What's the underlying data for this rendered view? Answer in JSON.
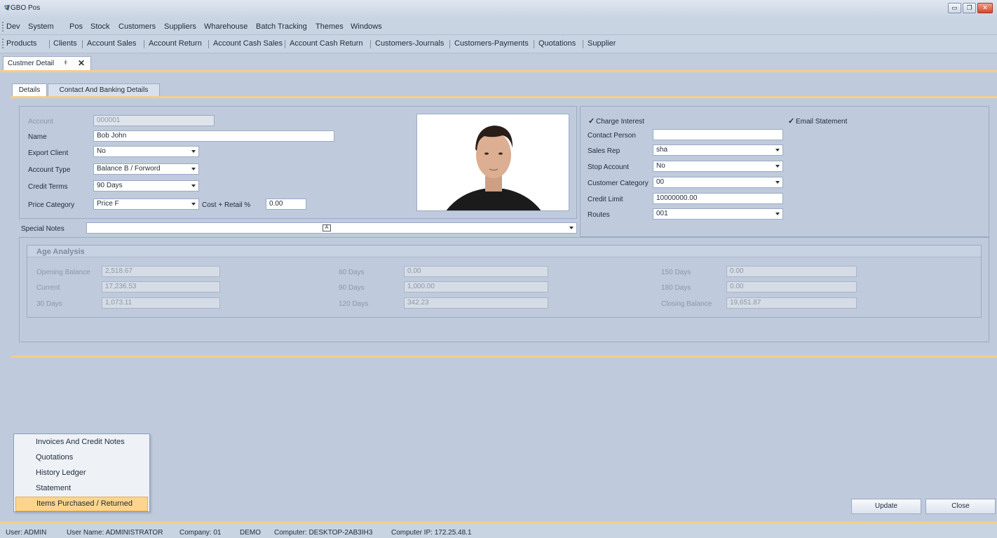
{
  "window": {
    "title": "GBO Pos"
  },
  "menu": [
    "Dev",
    "System",
    "Pos",
    "Stock",
    "Customers",
    "Suppliers",
    "Wharehouse",
    "Batch Tracking",
    "Themes",
    "Windows"
  ],
  "quick_links": [
    "Products",
    "Clients",
    "Account Sales",
    "Account Return",
    "Account Cash Sales",
    "Account Cash Return",
    "Customers-Journals",
    "Customers-Payments",
    "Quotations",
    "Supplier"
  ],
  "document_tab": {
    "label": "Custmer Detail",
    "pin": "ǂ",
    "close": "✕"
  },
  "tabs": {
    "details": "Details",
    "contact": "Contact And Banking Details"
  },
  "form": {
    "account_label": "Account",
    "account_value": "000001",
    "name_label": "Name",
    "name_value": "Bob John",
    "export_client_label": "Export Client",
    "export_client_value": "No",
    "account_type_label": "Account Type",
    "account_type_value": "Balance B / Forword",
    "credit_terms_label": "Credit Terms",
    "credit_terms_value": "90 Days",
    "price_category_label": "Price Category",
    "price_category_value": "Price F",
    "cost_retail_label": "Cost + Retail %",
    "cost_retail_value": "0.00",
    "special_notes_label": "Special Notes",
    "charge_interest_label": "Charge Interest",
    "email_statement_label": "Email Statement",
    "contact_person_label": "Contact Person",
    "contact_person_value": "",
    "sales_rep_label": "Sales Rep",
    "sales_rep_value": "sha",
    "stop_account_label": "Stop Account",
    "stop_account_value": "No",
    "customer_category_label": "Customer Category",
    "customer_category_value": "00",
    "credit_limit_label": "Credit Limit",
    "credit_limit_value": "10000000.00",
    "routes_label": "Routes",
    "routes_value": "001"
  },
  "age_analysis": {
    "title": "Age Analysis",
    "opening_balance_label": "Opening Balance",
    "opening_balance": "2,518.67",
    "current_label": "Current",
    "current": "17,236.53",
    "d30_label": "30 Days",
    "d30": "1,073.11",
    "d60_label": "60 Days",
    "d60": "0.00",
    "d90_label": "90 Days",
    "d90": "1,000.00",
    "d120_label": "120 Days",
    "d120": "342.23",
    "d150_label": "150 Days",
    "d150": "0.00",
    "d180_label": "180 Days",
    "d180": "0.00",
    "closing_balance_label": "Closing Balance",
    "closing_balance": "19,651.87"
  },
  "popup_menu": [
    "Invoices And Credit Notes",
    "Quotations",
    "History Ledger",
    "Statement",
    "Items Purchased / Returned"
  ],
  "buttons": {
    "update": "Update",
    "close": "Close"
  },
  "status": {
    "user": "User: ADMIN",
    "user_name": "User Name: ADMINISTRATOR",
    "company": "Company: 01",
    "company_name": "DEMO",
    "computer": "Computer: DESKTOP-2AB3IH3",
    "ip": "Computer IP: 172.25.48.1"
  },
  "icons": {
    "app": "app-logo-icon",
    "notes_editor": "text-editor-icon"
  },
  "colors": {
    "accent": "#f4ce86",
    "selected": "#fbd58d",
    "background": "#bfcbdc"
  }
}
